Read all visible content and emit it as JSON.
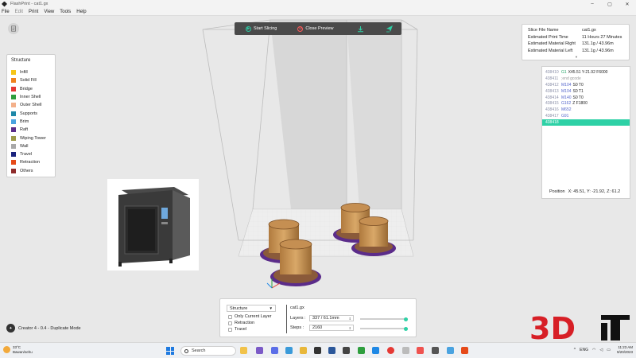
{
  "window": {
    "title": "FlashPrint - cat1.gx"
  },
  "menu": [
    "File",
    "Edit",
    "Print",
    "View",
    "Tools",
    "Help"
  ],
  "toolbar": {
    "start_label": "Start Slicing",
    "close_label": "Close Preview"
  },
  "legend": {
    "title": "Structure",
    "items": [
      {
        "label": "Infill",
        "color": "#f5c518"
      },
      {
        "label": "Solid Fill",
        "color": "#f0821e"
      },
      {
        "label": "Bridge",
        "color": "#e53935"
      },
      {
        "label": "Inner Shell",
        "color": "#2e9e3e"
      },
      {
        "label": "Outer Shell",
        "color": "#f3b08a"
      },
      {
        "label": "Supports",
        "color": "#1e88a8"
      },
      {
        "label": "Brim",
        "color": "#4aa3e0"
      },
      {
        "label": "Raft",
        "color": "#5b2c8a"
      },
      {
        "label": "Wiping Tower",
        "color": "#9e9a4a"
      },
      {
        "label": "Wall",
        "color": "#a8a8a8"
      },
      {
        "label": "Travel",
        "color": "#1a237e"
      },
      {
        "label": "Retraction",
        "color": "#e64a19"
      },
      {
        "label": "Others",
        "color": "#8e2b2b"
      }
    ]
  },
  "slice_info": [
    {
      "label": "Slice File Name",
      "value": "cat1.gx"
    },
    {
      "label": "Estimated Print Time",
      "value": "11 Hours 27 Minutes"
    },
    {
      "label": "Estimated Material Right",
      "value": "131.1g / 43.96m"
    },
    {
      "label": "Estimated Material Left",
      "value": "131.1g / 43.96m"
    }
  ],
  "gcode": [
    {
      "num": "438410",
      "cmd": "G1",
      "cmd_color": "green",
      "args": "X45.51 Y-21.92 F6000",
      "comment": ""
    },
    {
      "num": "438411",
      "cmd": "",
      "args": "",
      "comment": ";end gcode"
    },
    {
      "num": "438412",
      "cmd": "M104",
      "args": "S0 T0",
      "comment": ""
    },
    {
      "num": "438413",
      "cmd": "M104",
      "args": "S0 T1",
      "comment": ""
    },
    {
      "num": "438414",
      "cmd": "M140",
      "args": "S0 T0",
      "comment": ""
    },
    {
      "num": "438415",
      "cmd": "G162",
      "args": "Z F1800",
      "comment": ""
    },
    {
      "num": "438416",
      "cmd": "M652",
      "args": "",
      "comment": ""
    },
    {
      "num": "438417",
      "cmd": "G91",
      "args": "",
      "comment": ""
    },
    {
      "num": "438418",
      "cmd": "",
      "args": "",
      "comment": "",
      "selected": true
    }
  ],
  "position": {
    "label": "Position",
    "value": "X: 45.51, Y: -21.92, Z: 61.2"
  },
  "bottom": {
    "structure_select": "Structure",
    "only_current_layer": "Only Current Layer",
    "retraction": "Retraction",
    "travel": "Travel",
    "file_name": "cat1.gx",
    "layers_label": "Layers :",
    "layers_value": "337 / 61.1mm",
    "steps_label": "Steps :",
    "steps_value": "2160",
    "layers_fraction": 1.0,
    "steps_fraction": 1.0
  },
  "machine": "Creator 4 - 0.4 - Duplicate Mode",
  "watermark": "3D",
  "taskbar": {
    "weather_temp": "33°C",
    "weather_desc": "Bawan/sehu",
    "search": "Search",
    "time": "11:23 AM",
    "date": "9/20/2023",
    "lang": "ENG"
  }
}
